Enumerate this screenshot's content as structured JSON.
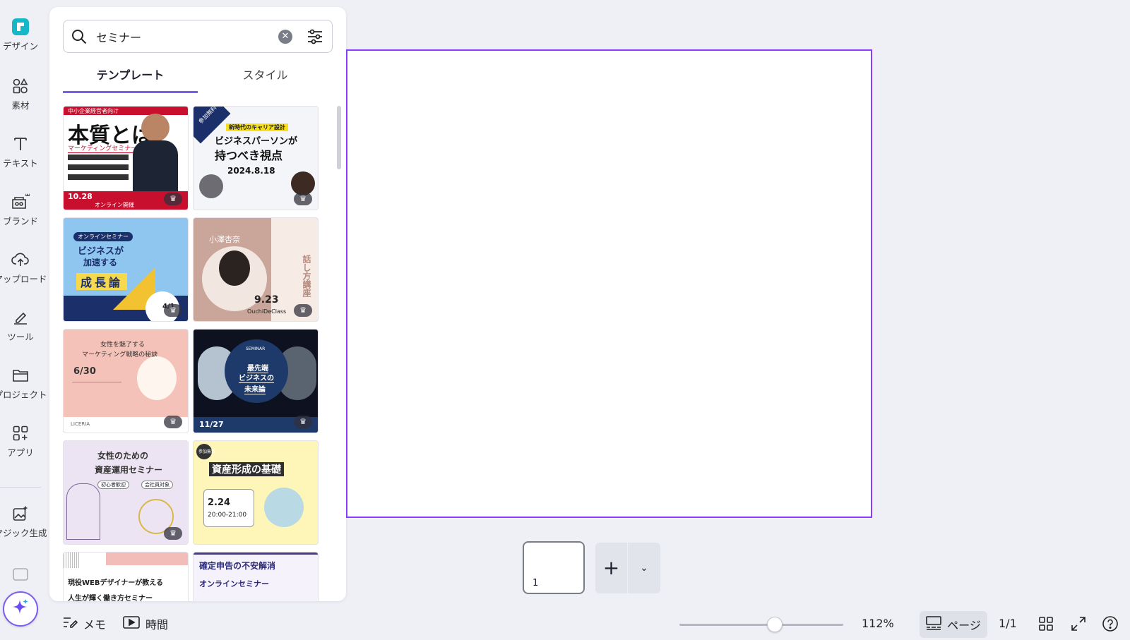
{
  "rail": {
    "items": [
      {
        "label": "デザイン",
        "icon": "design-icon"
      },
      {
        "label": "素材",
        "icon": "elements-icon"
      },
      {
        "label": "テキスト",
        "icon": "text-icon"
      },
      {
        "label": "ブランド",
        "icon": "brand-icon"
      },
      {
        "label": "アップロード",
        "icon": "upload-icon"
      },
      {
        "label": "ツール",
        "icon": "draw-icon"
      },
      {
        "label": "プロジェクト",
        "icon": "folder-icon"
      },
      {
        "label": "アプリ",
        "icon": "apps-icon"
      },
      {
        "label": "マジック生成",
        "icon": "magic-media-icon"
      }
    ]
  },
  "search": {
    "value": "セミナー"
  },
  "tabs": {
    "templates": "テンプレート",
    "styles": "スタイル"
  },
  "templates": [
    {
      "lines": [
        "中小企業経営者向け",
        "本質とは",
        "マーケティングセミナー",
        "10.28",
        "オンライン開催"
      ]
    },
    {
      "lines": [
        "参加無料",
        "新時代のキャリア設計",
        "ビジネスパーソンが",
        "持つべき視点",
        "2024.8.18"
      ]
    },
    {
      "lines": [
        "オンラインセミナー",
        "ビジネスが",
        "加速する",
        "成長論",
        "4/1"
      ]
    },
    {
      "lines": [
        "小澤杏奈",
        "話し方講座",
        "9.23",
        "OuchiDeClass"
      ]
    },
    {
      "lines": [
        "女性を魅了する",
        "マーケティング戦略の秘訣",
        "6/30",
        "LICERIA"
      ]
    },
    {
      "lines": [
        "SEMINAR",
        "最先端",
        "ビジネスの",
        "未来論",
        "11/27"
      ]
    },
    {
      "lines": [
        "女性のための",
        "資産運用セミナー",
        "初心者歓迎",
        "会社員対象"
      ]
    },
    {
      "lines": [
        "参加無料",
        "資産形成の基礎",
        "2.24",
        "20:00-21:00"
      ]
    },
    {
      "lines": [
        "現役WEBデザイナーが教える",
        "人生が輝く働き方セミナー"
      ]
    },
    {
      "lines": [
        "確定申告の不安解消",
        "オンラインセミナー"
      ]
    }
  ],
  "page": {
    "number": "1"
  },
  "bottom": {
    "notes": "メモ",
    "timer": "時間",
    "zoom": "112%",
    "zoom_fraction": 0.58,
    "pages": "ページ",
    "page_count": "1/1"
  },
  "colors": {
    "accent": "#8b3dff",
    "tab_underline": "#7d5cf0"
  }
}
